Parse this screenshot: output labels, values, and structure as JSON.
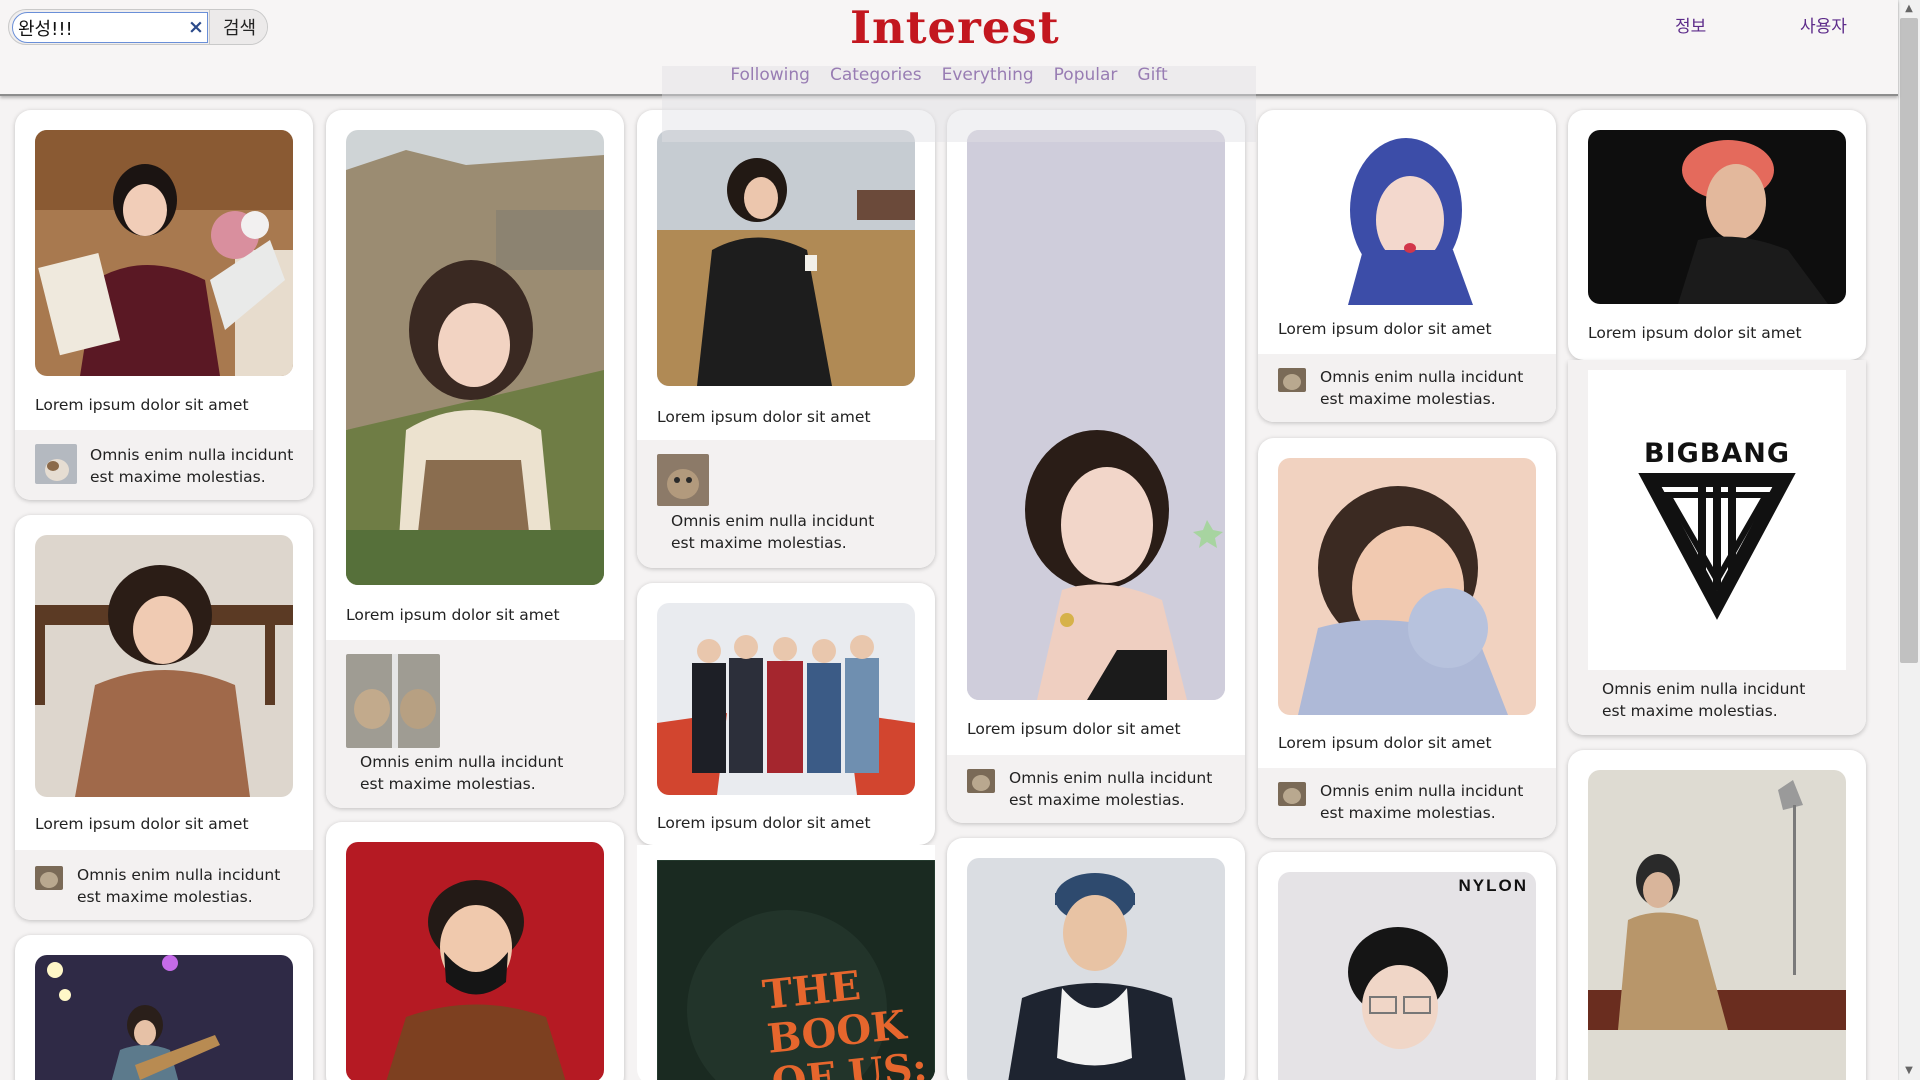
{
  "search": {
    "value": "완성!!!",
    "button_label": "검색",
    "clear_icon": "close-icon"
  },
  "header": {
    "logo": "Interest",
    "info_link": "정보",
    "user_link": "사용자"
  },
  "nav": [
    "Following",
    "Categories",
    "Everything",
    "Popular",
    "Gift"
  ],
  "colors": {
    "logo": "#c3171f",
    "nav_text": "#5d2b8a",
    "card_bg": "#ffffff",
    "card_footer": "#f3f1f1"
  },
  "cards": {
    "title": "Lorem ipsum dolor sit amet",
    "desc_line1": "Omnis enim nulla incidunt",
    "desc_line2": "est maxime molestias."
  },
  "images": {
    "bigbang_logo": "BIGBANG",
    "album_title": "THE BOOK OF US:",
    "nylon_logo": "NYLON"
  }
}
